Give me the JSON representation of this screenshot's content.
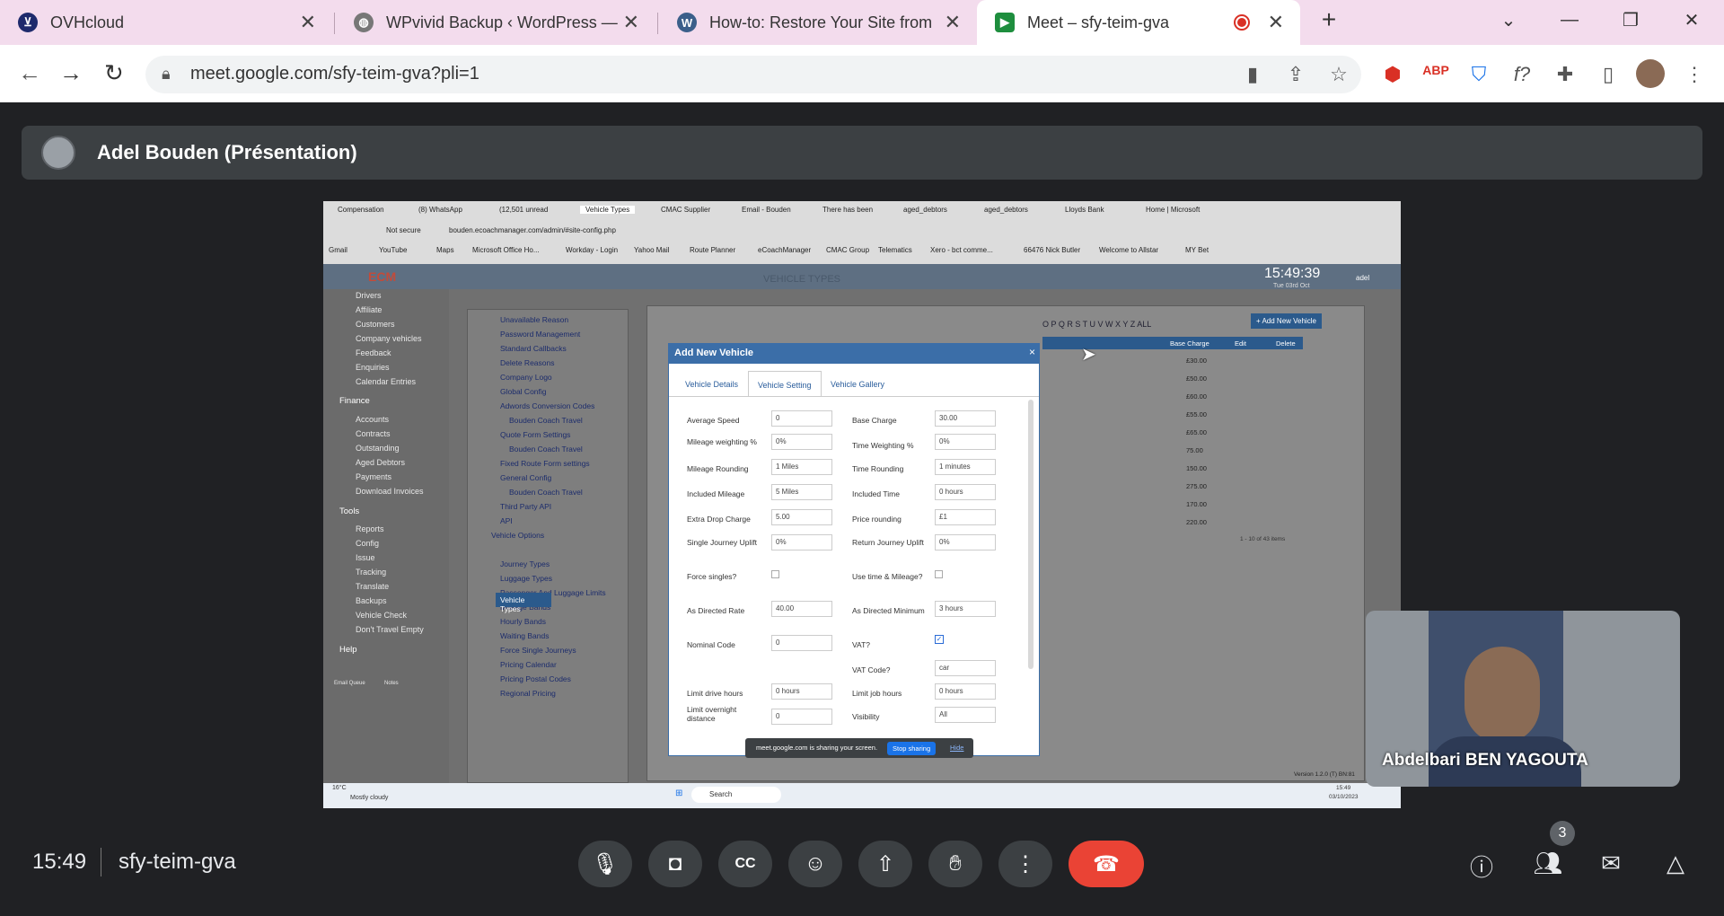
{
  "tabs": [
    {
      "title": "OVHcloud",
      "icon": "ovh-icon",
      "color": "#1e2a6c"
    },
    {
      "title": "WPvivid Backup ‹ WordPress — ",
      "icon": "globe-icon",
      "color": "#555"
    },
    {
      "title": "How-to: Restore Your Site from ",
      "icon": "wordpress-icon",
      "color": "#3b5f8a"
    },
    {
      "title": "Meet – sfy-teim-gva",
      "icon": "meet-icon",
      "color": "#1e8e3e"
    }
  ],
  "toolbar": {
    "url": "meet.google.com/sfy-teim-gva?pli=1"
  },
  "presentation": {
    "title": "Adel Bouden (Présentation)"
  },
  "shared": {
    "tabs": [
      "Compensation",
      "(8) WhatsApp",
      "(12,501 unread",
      "Vehicle Types",
      "CMAC Supplier",
      "Email - Bouden",
      "There has been",
      "aged_debtors",
      "aged_debtors",
      "Lloyds Bank",
      "Home | Microsoft"
    ],
    "not_secure": "Not secure",
    "url": "bouden.ecoachmanager.com/admin/#site-config.php",
    "bookmarks": [
      "Gmail",
      "YouTube",
      "Maps",
      "Microsoft Office Ho...",
      "Workday - Login",
      "Yahoo Mail",
      "Route Planner",
      "eCoachManager",
      "CMAC Group",
      "Telematics",
      "Xero - bct comme...",
      "66476 Nick Butler",
      "Welcome to Allstar",
      "MY Bet"
    ],
    "header_title": "VEHICLE TYPES",
    "time": "15:49:39",
    "date": "Tue 03rd Oct",
    "user": "adel",
    "nav": [
      "Drivers",
      "Affiliate",
      "Customers",
      "Company vehicles",
      "Feedback",
      "Enquiries",
      "Calendar Entries"
    ],
    "finance": "Finance",
    "finance_items": [
      "Accounts",
      "Contracts",
      "Outstanding",
      "Aged Debtors",
      "Payments",
      "Download Invoices"
    ],
    "tools": "Tools",
    "tools_items": [
      "Reports",
      "Config",
      "Issue",
      "Tracking",
      "Translate",
      "Backups",
      "Vehicle Check",
      "Don't Travel Empty"
    ],
    "help": "Help",
    "tree": [
      "Unavailable Reason",
      "Password Management",
      "Standard Callbacks",
      "Delete Reasons",
      "Company Logo",
      "Global Config",
      "Adwords Conversion Codes",
      "Bouden Coach Travel",
      "Quote Form Settings",
      "Bouden Coach Travel",
      "Fixed Route Form settings",
      "General Config",
      "Bouden Coach Travel",
      "Third Party API",
      "API",
      "Vehicle Options",
      "Vehicle Types",
      "Journey Types",
      "Luggage Types",
      "Passenger And Luggage Limits",
      "Mileage Bands",
      "Hourly Bands",
      "Waiting Bands",
      "Force Single Journeys",
      "Pricing Calendar",
      "Pricing Postal Codes",
      "Regional Pricing"
    ],
    "alpha": "O P Q R S T U V W X Y Z ALL",
    "add_new": "+ Add New Vehicle",
    "cols": [
      "Base Charge",
      "Edit",
      "Delete"
    ],
    "base_charges": [
      "£30.00",
      "£50.00",
      "£60.00",
      "£55.00",
      "£65.00",
      "75.00",
      "150.00",
      "275.00",
      "170.00",
      "220.00"
    ],
    "pager": "1 - 10 of 43 items",
    "version": "Version 1.2.0 (T) BN:81",
    "modal": {
      "title": "Add New Vehicle",
      "tabs": [
        "Vehicle Details",
        "Vehicle Setting",
        "Vehicle Gallery"
      ],
      "left": [
        {
          "label": "Average Speed",
          "value": "0"
        },
        {
          "label": "Mileage weighting %",
          "value": "0%"
        },
        {
          "label": "Mileage Rounding",
          "value": "1 Miles"
        },
        {
          "label": "Included Mileage",
          "value": "5 Miles"
        },
        {
          "label": "Extra Drop Charge",
          "value": "5.00"
        },
        {
          "label": "Single Journey Uplift",
          "value": "0%"
        },
        {
          "label": "Force singles?",
          "value": ""
        },
        {
          "label": "As Directed Rate",
          "value": "40.00"
        },
        {
          "label": "Nominal Code",
          "value": "0"
        },
        {
          "label": "",
          "value": ""
        },
        {
          "label": "Limit drive hours",
          "value": "0 hours"
        },
        {
          "label": "Limit overnight distance",
          "value": "0"
        }
      ],
      "right": [
        {
          "label": "Base Charge",
          "value": "30.00"
        },
        {
          "label": "Time Weighting %",
          "value": "0%"
        },
        {
          "label": "Time Rounding",
          "value": "1 minutes"
        },
        {
          "label": "Included Time",
          "value": "0 hours"
        },
        {
          "label": "Price rounding",
          "value": "£1"
        },
        {
          "label": "Return Journey Uplift",
          "value": "0%"
        },
        {
          "label": "Use time & Mileage?",
          "value": ""
        },
        {
          "label": "As Directed Minimum",
          "value": "3 hours"
        },
        {
          "label": "VAT?",
          "value": ""
        },
        {
          "label": "VAT Code?",
          "value": "car"
        },
        {
          "label": "Limit job hours",
          "value": "0 hours"
        },
        {
          "label": "Visibility",
          "value": "All"
        }
      ]
    },
    "toast": {
      "text": "meet.google.com is sharing your screen.",
      "stop": "Stop sharing",
      "hide": "Hide"
    },
    "taskbar": {
      "weather_temp": "16°C",
      "weather_text": "Mostly cloudy",
      "search": "Search",
      "time": "15:49",
      "date": "03/10/2023"
    },
    "email_queue": "Email Queue",
    "notes": "Notes"
  },
  "participant": {
    "name": "Abdelbari BEN YAGOUTA"
  },
  "bottom": {
    "time": "15:49",
    "code": "sfy-teim-gva",
    "people_count": "3"
  }
}
